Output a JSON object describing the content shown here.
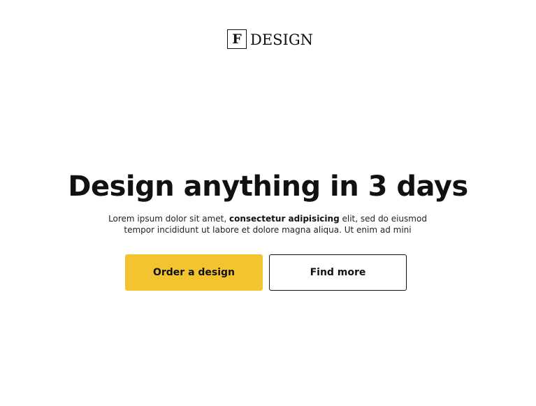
{
  "logo": {
    "mark": "F",
    "text": "DESIGN"
  },
  "hero": {
    "title": "Design anything in 3 days",
    "description_before": "Lorem ipsum dolor sit amet, ",
    "description_bold": "consectetur adipisicing",
    "description_after": " elit, sed do eiusmod tempor incididunt ut labore et dolore magna aliqua. Ut enim ad mini"
  },
  "buttons": {
    "primary_label": "Order a design",
    "secondary_label": "Find more"
  },
  "colors": {
    "accent": "#f4c330",
    "text": "#111111",
    "background": "#ffffff"
  }
}
